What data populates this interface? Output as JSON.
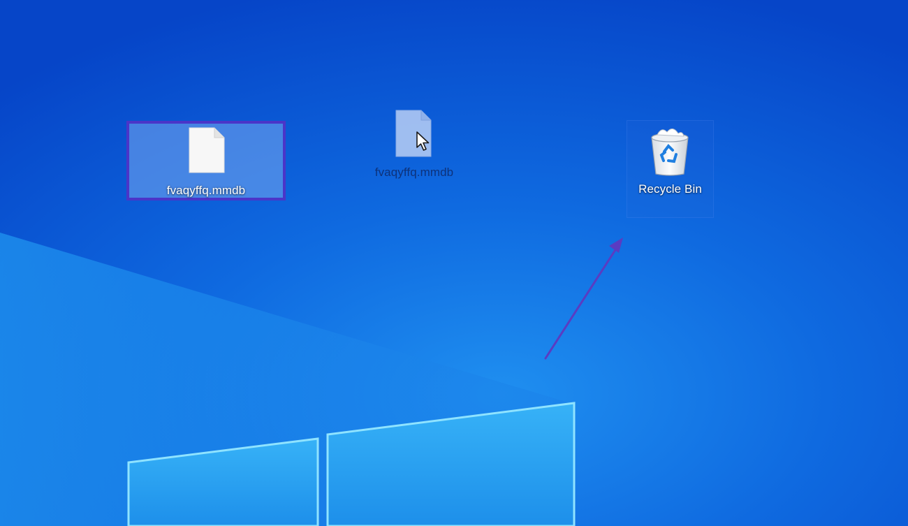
{
  "desktop": {
    "background_color": "#0a58d6",
    "icons": {
      "selected_file": {
        "label": "fvaqyffq.mmdb",
        "icon": "document-icon",
        "selection_color": "#4b35c8"
      },
      "dragging_file": {
        "label": "fvaqyffq.mmdb",
        "icon": "document-icon",
        "cursor": "arrow-cursor-icon"
      },
      "recycle_bin": {
        "label": "Recycle Bin",
        "icon": "recycle-bin-icon"
      }
    },
    "annotation": {
      "arrow_color": "#5a3cc2",
      "icon": "drag-arrow-icon"
    }
  }
}
